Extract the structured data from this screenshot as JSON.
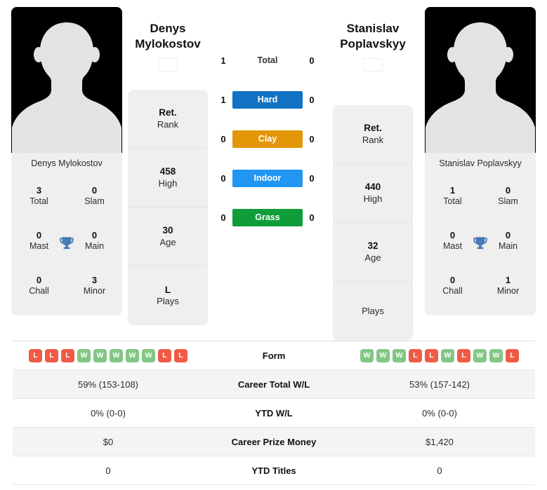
{
  "players": {
    "left": {
      "name_line1": "Denys",
      "name_line2": "Mylokostov",
      "full_name": "Denys Mylokostov",
      "flag": {
        "name": "ukraine-flag",
        "top_color": "#0a6ec4",
        "bottom_color": "#f8d64a"
      },
      "titles": {
        "total_value": "3",
        "total_label": "Total",
        "slam_value": "0",
        "slam_label": "Slam",
        "mast_value": "0",
        "mast_label": "Mast",
        "main_value": "0",
        "main_label": "Main",
        "chall_value": "0",
        "chall_label": "Chall",
        "minor_value": "3",
        "minor_label": "Minor"
      },
      "ranks": [
        {
          "value": "Ret.",
          "label": "Rank"
        },
        {
          "value": "458",
          "label": "High"
        },
        {
          "value": "30",
          "label": "Age"
        },
        {
          "value": "L",
          "label": "Plays"
        }
      ],
      "form": [
        "L",
        "L",
        "L",
        "W",
        "W",
        "W",
        "W",
        "W",
        "L",
        "L"
      ],
      "career_total_wl": "59% (153-108)",
      "ytd_wl": "0% (0-0)",
      "career_prize_money": "$0",
      "ytd_titles": "0"
    },
    "right": {
      "name_line1": "Stanislav",
      "name_line2": "Poplavskyy",
      "full_name": "Stanislav Poplavskyy",
      "flag": {
        "name": "ukraine-flag",
        "top_color": "#0a6ec4",
        "bottom_color": "#f8d64a"
      },
      "titles": {
        "total_value": "1",
        "total_label": "Total",
        "slam_value": "0",
        "slam_label": "Slam",
        "mast_value": "0",
        "mast_label": "Mast",
        "main_value": "0",
        "main_label": "Main",
        "chall_value": "0",
        "chall_label": "Chall",
        "minor_value": "1",
        "minor_label": "Minor"
      },
      "ranks": [
        {
          "value": "Ret.",
          "label": "Rank"
        },
        {
          "value": "440",
          "label": "High"
        },
        {
          "value": "32",
          "label": "Age"
        },
        {
          "value": "",
          "label": "Plays"
        }
      ],
      "form": [
        "W",
        "W",
        "W",
        "L",
        "L",
        "W",
        "L",
        "W",
        "W",
        "L"
      ],
      "career_total_wl": "53% (157-142)",
      "ytd_wl": "0% (0-0)",
      "career_prize_money": "$1,420",
      "ytd_titles": "0"
    }
  },
  "head_to_head": [
    {
      "label": "Total",
      "left": "1",
      "right": "0",
      "color": "",
      "pill": false
    },
    {
      "label": "Hard",
      "left": "1",
      "right": "0",
      "color": "#1272c4",
      "pill": true
    },
    {
      "label": "Clay",
      "left": "0",
      "right": "0",
      "color": "#e39608",
      "pill": true
    },
    {
      "label": "Indoor",
      "left": "0",
      "right": "0",
      "color": "#2196f3",
      "pill": true
    },
    {
      "label": "Grass",
      "left": "0",
      "right": "0",
      "color": "#0f9d3a",
      "pill": true
    }
  ],
  "table": {
    "rows": [
      {
        "label": "Form",
        "type": "form",
        "shade": false,
        "left_key": "form",
        "right_key": "form"
      },
      {
        "label": "Career Total W/L",
        "type": "text",
        "shade": true,
        "left_key": "career_total_wl",
        "right_key": "career_total_wl"
      },
      {
        "label": "YTD W/L",
        "type": "text",
        "shade": false,
        "left_key": "ytd_wl",
        "right_key": "ytd_wl"
      },
      {
        "label": "Career Prize Money",
        "type": "text",
        "shade": true,
        "left_key": "career_prize_money",
        "right_key": "career_prize_money"
      },
      {
        "label": "YTD Titles",
        "type": "text",
        "shade": false,
        "left_key": "ytd_titles",
        "right_key": "ytd_titles"
      }
    ]
  },
  "icons": {
    "trophy": "trophy-icon",
    "avatar": "avatar-silhouette-icon"
  },
  "colors": {
    "trophy": "#4a7ab5",
    "win": "#82c784",
    "loss": "#ef5b46",
    "card_bg": "#efefef"
  }
}
